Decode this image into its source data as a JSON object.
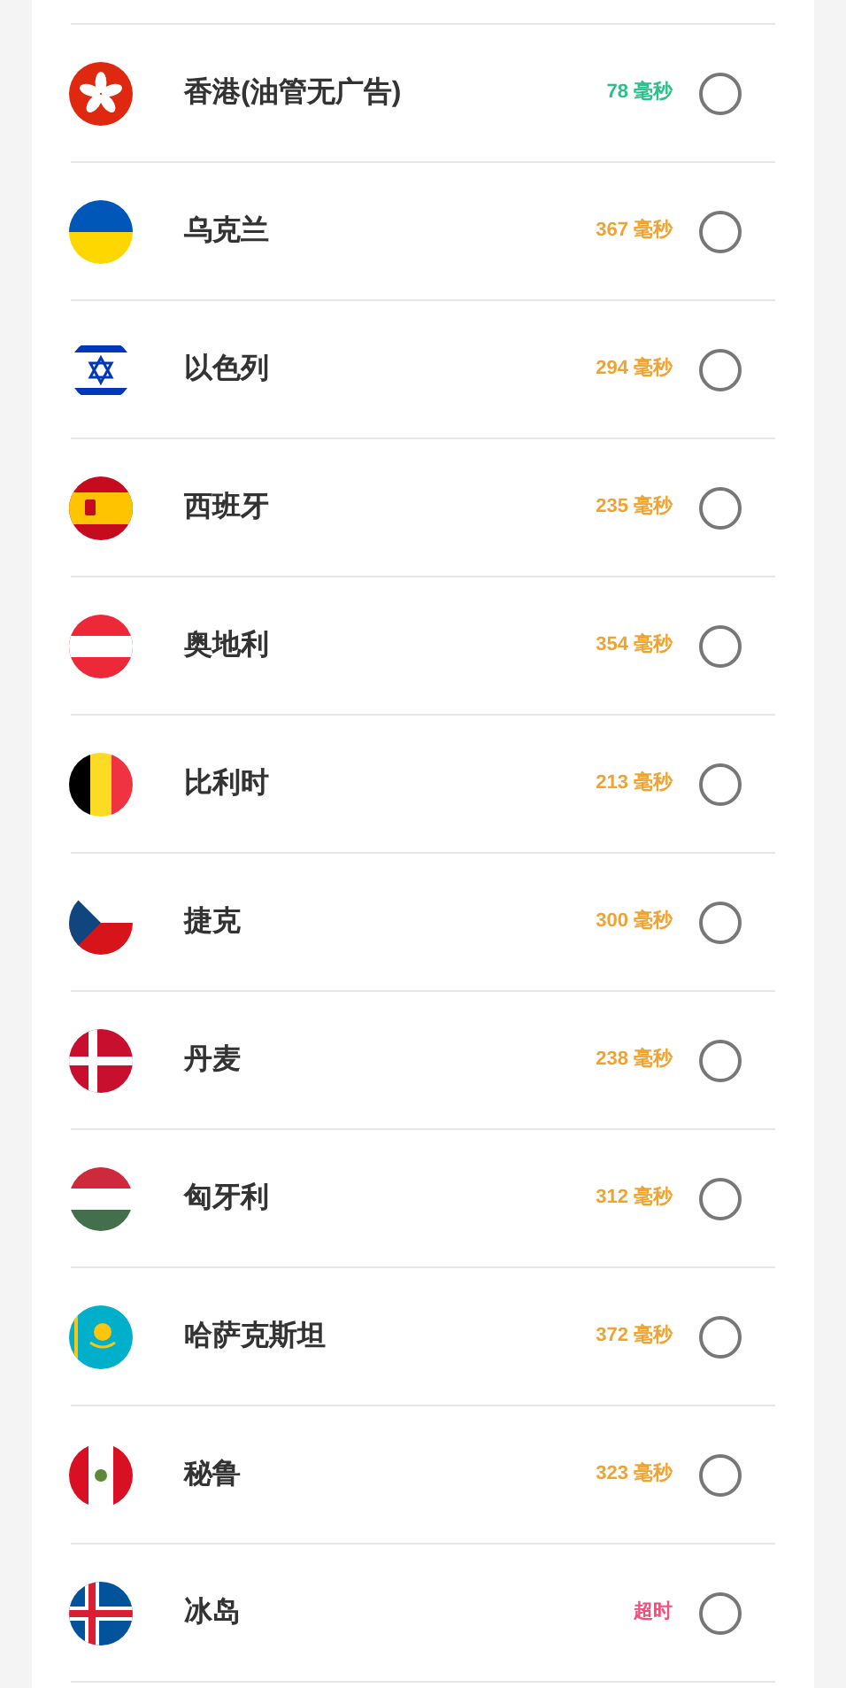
{
  "servers": [
    {
      "kind": "hk",
      "name": "香港(油管无广告)",
      "latency": "78 毫秒",
      "color": "#2bbf8a",
      "selected": false
    },
    {
      "kind": "ua",
      "name": "乌克兰",
      "latency": "367 毫秒",
      "color": "#f0a330",
      "selected": false
    },
    {
      "kind": "il",
      "name": "以色列",
      "latency": "294 毫秒",
      "color": "#f0a330",
      "selected": false
    },
    {
      "kind": "es",
      "name": "西班牙",
      "latency": "235 毫秒",
      "color": "#f0a330",
      "selected": false
    },
    {
      "kind": "at",
      "name": "奥地利",
      "latency": "354 毫秒",
      "color": "#f0a330",
      "selected": false
    },
    {
      "kind": "be",
      "name": "比利时",
      "latency": "213 毫秒",
      "color": "#f0a330",
      "selected": false
    },
    {
      "kind": "cz",
      "name": "捷克",
      "latency": "300 毫秒",
      "color": "#f0a330",
      "selected": false
    },
    {
      "kind": "dk",
      "name": "丹麦",
      "latency": "238 毫秒",
      "color": "#f0a330",
      "selected": false
    },
    {
      "kind": "hu",
      "name": "匈牙利",
      "latency": "312 毫秒",
      "color": "#f0a330",
      "selected": false
    },
    {
      "kind": "kz",
      "name": "哈萨克斯坦",
      "latency": "372 毫秒",
      "color": "#f0a330",
      "selected": false
    },
    {
      "kind": "pe",
      "name": "秘鲁",
      "latency": "323 毫秒",
      "color": "#f0a330",
      "selected": false
    },
    {
      "kind": "is",
      "name": "冰岛",
      "latency": "超时",
      "color": "#f0507a",
      "selected": false
    }
  ]
}
